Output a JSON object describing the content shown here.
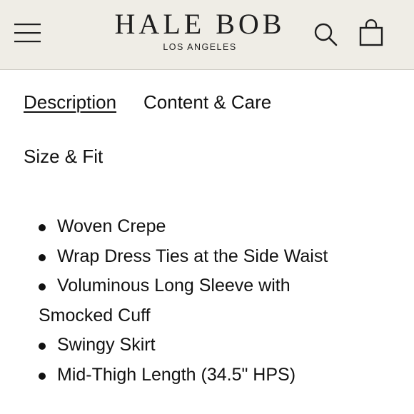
{
  "header": {
    "logo_name": "HALE BOB",
    "logo_subtitle": "LOS ANGELES",
    "menu_icon": "hamburger-menu-icon",
    "search_icon": "search-icon",
    "bag_icon": "shopping-bag-icon",
    "background": "#efede6"
  },
  "tabs": [
    {
      "label": "Description",
      "active": true
    },
    {
      "label": "Content & Care",
      "active": false
    },
    {
      "label": "Size & Fit",
      "active": false
    }
  ],
  "description": {
    "bullets": [
      "Woven Crepe",
      "Wrap Dress Ties at the Side Waist",
      "Voluminous Long Sleeve with",
      "Smocked Cuff",
      "Swingy Skirt",
      "Mid-Thigh Length (34.5\" HPS)"
    ]
  }
}
